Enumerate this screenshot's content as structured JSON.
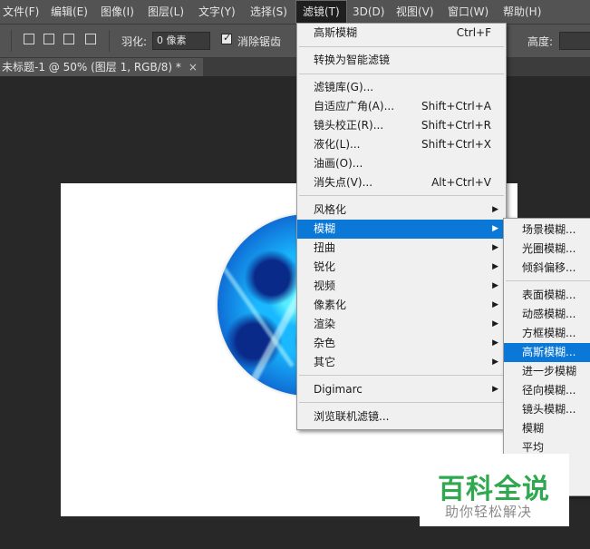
{
  "menubar": {
    "items": [
      "文件(F)",
      "编辑(E)",
      "图像(I)",
      "图层(L)",
      "文字(Y)",
      "选择(S)",
      "滤镜(T)",
      "3D(D)",
      "视图(V)",
      "窗口(W)",
      "帮助(H)"
    ],
    "active": "滤镜(T)"
  },
  "options": {
    "feather_label": "羽化:",
    "feather_value": "0 像素",
    "antialias_label": "消除锯齿",
    "height_label": "高度:"
  },
  "document": {
    "tab_title": "未标题-1 @ 50% (图层 1, RGB/8) *",
    "close": "×"
  },
  "filter_menu": {
    "items": [
      {
        "label": "高斯模糊",
        "shortcut": "Ctrl+F"
      },
      {
        "label": "转换为智能滤镜",
        "shortcut": ""
      },
      {
        "label": "滤镜库(G)...",
        "shortcut": ""
      },
      {
        "label": "自适应广角(A)...",
        "shortcut": "Shift+Ctrl+A"
      },
      {
        "label": "镜头校正(R)...",
        "shortcut": "Shift+Ctrl+R"
      },
      {
        "label": "液化(L)...",
        "shortcut": "Shift+Ctrl+X"
      },
      {
        "label": "油画(O)...",
        "shortcut": ""
      },
      {
        "label": "消失点(V)...",
        "shortcut": "Alt+Ctrl+V"
      },
      {
        "label": "风格化",
        "shortcut": ""
      },
      {
        "label": "模糊",
        "shortcut": ""
      },
      {
        "label": "扭曲",
        "shortcut": ""
      },
      {
        "label": "锐化",
        "shortcut": ""
      },
      {
        "label": "视频",
        "shortcut": ""
      },
      {
        "label": "像素化",
        "shortcut": ""
      },
      {
        "label": "渲染",
        "shortcut": ""
      },
      {
        "label": "杂色",
        "shortcut": ""
      },
      {
        "label": "其它",
        "shortcut": ""
      },
      {
        "label": "Digimarc",
        "shortcut": ""
      },
      {
        "label": "浏览联机滤镜...",
        "shortcut": ""
      }
    ],
    "highlighted": "模糊"
  },
  "blur_submenu": {
    "items": [
      "场景模糊...",
      "光圈模糊...",
      "倾斜偏移...",
      "表面模糊...",
      "动感模糊...",
      "方框模糊...",
      "高斯模糊...",
      "进一步模糊",
      "径向模糊...",
      "镜头模糊...",
      "模糊",
      "平均",
      "...",
      "..."
    ],
    "highlighted": "高斯模糊..."
  },
  "watermark": {
    "title": "百科全说",
    "subtitle": "助你轻松解决"
  },
  "colors": {
    "highlight": "#0b78d7",
    "menubar_bg": "#535353",
    "workspace_bg": "#282828",
    "watermark_green": "#2fa84f"
  }
}
